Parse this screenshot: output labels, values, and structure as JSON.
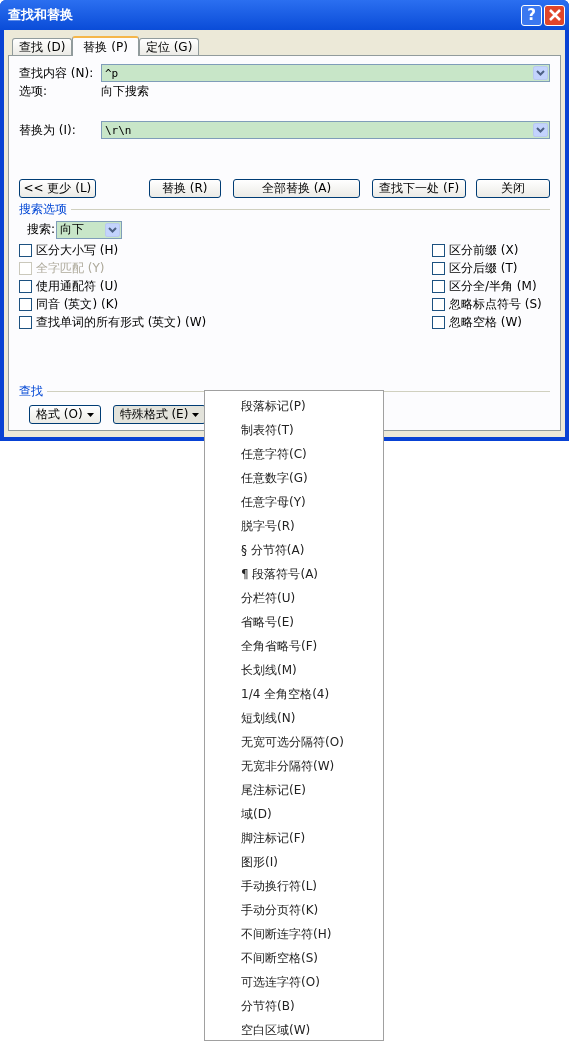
{
  "window": {
    "title": "查找和替换",
    "help_label": "?"
  },
  "tabs": [
    {
      "label": "查找 (D)",
      "selected": false
    },
    {
      "label": "替换 (P)",
      "selected": true
    },
    {
      "label": "定位 (G)",
      "selected": false
    }
  ],
  "find": {
    "label": "查找内容 (N):",
    "value": "^p"
  },
  "options": {
    "label": "选项:",
    "value": "向下搜索"
  },
  "replace": {
    "label": "替换为 (I):",
    "value": "\\r\\n"
  },
  "buttons": [
    "<< 更少 (L)",
    "替换 (R)",
    "全部替换 (A)",
    "查找下一处 (F)",
    "关闭"
  ],
  "search_options": {
    "title": "搜索选项",
    "search_label": "搜索:",
    "search_value": "向下",
    "left_checks": [
      {
        "label": "区分大小写 (H)",
        "checked": false,
        "disabled": false
      },
      {
        "label": "全字匹配 (Y)",
        "checked": false,
        "disabled": true
      },
      {
        "label": "使用通配符 (U)",
        "checked": false,
        "disabled": false
      },
      {
        "label": "同音 (英文) (K)",
        "checked": false,
        "disabled": false
      },
      {
        "label": "查找单词的所有形式 (英文) (W)",
        "checked": false,
        "disabled": false
      }
    ],
    "right_checks": [
      {
        "label": "区分前缀 (X)",
        "checked": false,
        "disabled": false
      },
      {
        "label": "区分后缀 (T)",
        "checked": false,
        "disabled": false
      },
      {
        "label": "区分全/半角 (M)",
        "checked": false,
        "disabled": false
      },
      {
        "label": "忽略标点符号 (S)",
        "checked": false,
        "disabled": false
      },
      {
        "label": "忽略空格 (W)",
        "checked": false,
        "disabled": false
      }
    ]
  },
  "find_section": {
    "title": "查找",
    "buttons": [
      {
        "label": "格式 (O)",
        "pressed": false
      },
      {
        "label": "特殊格式 (E)",
        "pressed": true
      }
    ]
  },
  "menu": {
    "items": [
      "段落标记(P)",
      "制表符(T)",
      "任意字符(C)",
      "任意数字(G)",
      "任意字母(Y)",
      "脱字号(R)",
      "§ 分节符(A)",
      "¶ 段落符号(A)",
      "分栏符(U)",
      "省略号(E)",
      "全角省略号(F)",
      "长划线(M)",
      "1/4 全角空格(4)",
      "短划线(N)",
      "无宽可选分隔符(O)",
      "无宽非分隔符(W)",
      "尾注标记(E)",
      "域(D)",
      "脚注标记(F)",
      "图形(I)",
      "手动换行符(L)",
      "手动分页符(K)",
      "不间断连字符(H)",
      "不间断空格(S)",
      "可选连字符(O)",
      "分节符(B)",
      "空白区域(W)"
    ]
  }
}
